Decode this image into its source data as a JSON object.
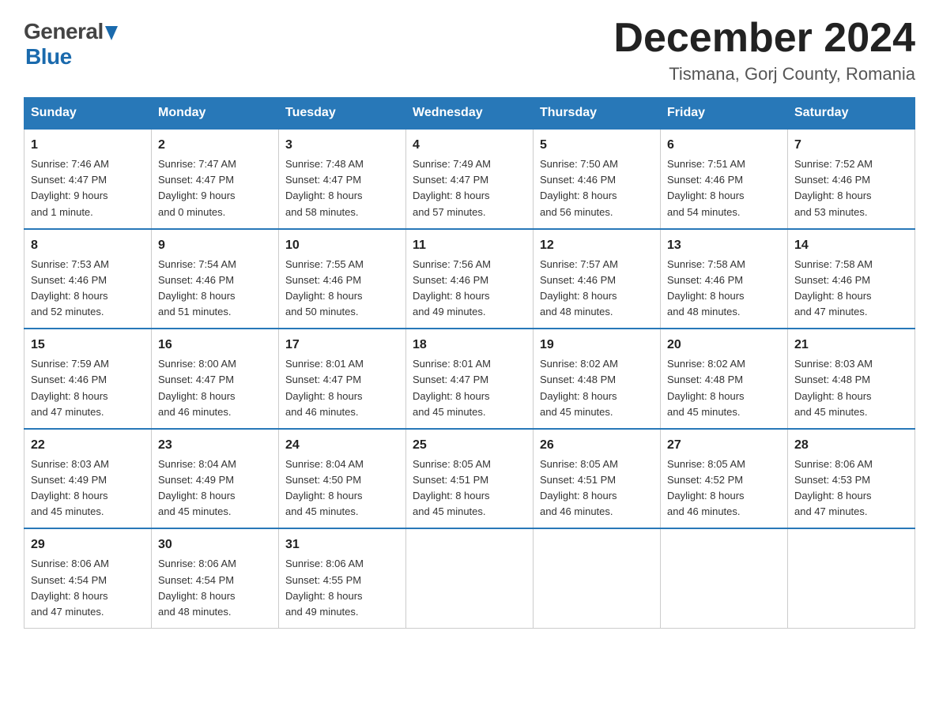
{
  "header": {
    "logo_general": "General",
    "logo_blue": "Blue",
    "month_title": "December 2024",
    "location": "Tismana, Gorj County, Romania"
  },
  "days_of_week": [
    "Sunday",
    "Monday",
    "Tuesday",
    "Wednesday",
    "Thursday",
    "Friday",
    "Saturday"
  ],
  "weeks": [
    [
      {
        "num": "1",
        "info": "Sunrise: 7:46 AM\nSunset: 4:47 PM\nDaylight: 9 hours\nand 1 minute."
      },
      {
        "num": "2",
        "info": "Sunrise: 7:47 AM\nSunset: 4:47 PM\nDaylight: 9 hours\nand 0 minutes."
      },
      {
        "num": "3",
        "info": "Sunrise: 7:48 AM\nSunset: 4:47 PM\nDaylight: 8 hours\nand 58 minutes."
      },
      {
        "num": "4",
        "info": "Sunrise: 7:49 AM\nSunset: 4:47 PM\nDaylight: 8 hours\nand 57 minutes."
      },
      {
        "num": "5",
        "info": "Sunrise: 7:50 AM\nSunset: 4:46 PM\nDaylight: 8 hours\nand 56 minutes."
      },
      {
        "num": "6",
        "info": "Sunrise: 7:51 AM\nSunset: 4:46 PM\nDaylight: 8 hours\nand 54 minutes."
      },
      {
        "num": "7",
        "info": "Sunrise: 7:52 AM\nSunset: 4:46 PM\nDaylight: 8 hours\nand 53 minutes."
      }
    ],
    [
      {
        "num": "8",
        "info": "Sunrise: 7:53 AM\nSunset: 4:46 PM\nDaylight: 8 hours\nand 52 minutes."
      },
      {
        "num": "9",
        "info": "Sunrise: 7:54 AM\nSunset: 4:46 PM\nDaylight: 8 hours\nand 51 minutes."
      },
      {
        "num": "10",
        "info": "Sunrise: 7:55 AM\nSunset: 4:46 PM\nDaylight: 8 hours\nand 50 minutes."
      },
      {
        "num": "11",
        "info": "Sunrise: 7:56 AM\nSunset: 4:46 PM\nDaylight: 8 hours\nand 49 minutes."
      },
      {
        "num": "12",
        "info": "Sunrise: 7:57 AM\nSunset: 4:46 PM\nDaylight: 8 hours\nand 48 minutes."
      },
      {
        "num": "13",
        "info": "Sunrise: 7:58 AM\nSunset: 4:46 PM\nDaylight: 8 hours\nand 48 minutes."
      },
      {
        "num": "14",
        "info": "Sunrise: 7:58 AM\nSunset: 4:46 PM\nDaylight: 8 hours\nand 47 minutes."
      }
    ],
    [
      {
        "num": "15",
        "info": "Sunrise: 7:59 AM\nSunset: 4:46 PM\nDaylight: 8 hours\nand 47 minutes."
      },
      {
        "num": "16",
        "info": "Sunrise: 8:00 AM\nSunset: 4:47 PM\nDaylight: 8 hours\nand 46 minutes."
      },
      {
        "num": "17",
        "info": "Sunrise: 8:01 AM\nSunset: 4:47 PM\nDaylight: 8 hours\nand 46 minutes."
      },
      {
        "num": "18",
        "info": "Sunrise: 8:01 AM\nSunset: 4:47 PM\nDaylight: 8 hours\nand 45 minutes."
      },
      {
        "num": "19",
        "info": "Sunrise: 8:02 AM\nSunset: 4:48 PM\nDaylight: 8 hours\nand 45 minutes."
      },
      {
        "num": "20",
        "info": "Sunrise: 8:02 AM\nSunset: 4:48 PM\nDaylight: 8 hours\nand 45 minutes."
      },
      {
        "num": "21",
        "info": "Sunrise: 8:03 AM\nSunset: 4:48 PM\nDaylight: 8 hours\nand 45 minutes."
      }
    ],
    [
      {
        "num": "22",
        "info": "Sunrise: 8:03 AM\nSunset: 4:49 PM\nDaylight: 8 hours\nand 45 minutes."
      },
      {
        "num": "23",
        "info": "Sunrise: 8:04 AM\nSunset: 4:49 PM\nDaylight: 8 hours\nand 45 minutes."
      },
      {
        "num": "24",
        "info": "Sunrise: 8:04 AM\nSunset: 4:50 PM\nDaylight: 8 hours\nand 45 minutes."
      },
      {
        "num": "25",
        "info": "Sunrise: 8:05 AM\nSunset: 4:51 PM\nDaylight: 8 hours\nand 45 minutes."
      },
      {
        "num": "26",
        "info": "Sunrise: 8:05 AM\nSunset: 4:51 PM\nDaylight: 8 hours\nand 46 minutes."
      },
      {
        "num": "27",
        "info": "Sunrise: 8:05 AM\nSunset: 4:52 PM\nDaylight: 8 hours\nand 46 minutes."
      },
      {
        "num": "28",
        "info": "Sunrise: 8:06 AM\nSunset: 4:53 PM\nDaylight: 8 hours\nand 47 minutes."
      }
    ],
    [
      {
        "num": "29",
        "info": "Sunrise: 8:06 AM\nSunset: 4:54 PM\nDaylight: 8 hours\nand 47 minutes."
      },
      {
        "num": "30",
        "info": "Sunrise: 8:06 AM\nSunset: 4:54 PM\nDaylight: 8 hours\nand 48 minutes."
      },
      {
        "num": "31",
        "info": "Sunrise: 8:06 AM\nSunset: 4:55 PM\nDaylight: 8 hours\nand 49 minutes."
      },
      null,
      null,
      null,
      null
    ]
  ]
}
